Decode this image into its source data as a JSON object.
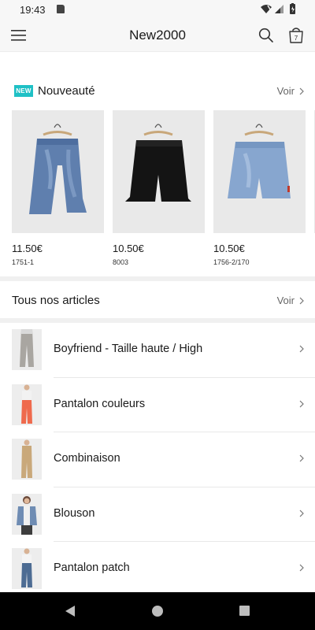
{
  "status_bar": {
    "time": "19:43"
  },
  "app_bar": {
    "title": "New2000",
    "cart_count": "7"
  },
  "new_section": {
    "badge": "NEW",
    "title": "Nouveauté",
    "see_all": "Voir",
    "products": [
      {
        "price": "11.50€",
        "ref": "1751-1",
        "color": "#5f7fae"
      },
      {
        "price": "10.50€",
        "ref": "8003",
        "color": "#141414"
      },
      {
        "price": "10.50€",
        "ref": "1756-2/170",
        "color": "#87a6cf"
      }
    ]
  },
  "all_section": {
    "title": "Tous nos articles",
    "see_all": "Voir"
  },
  "categories": [
    {
      "label": "Boyfriend - Taille haute / High",
      "color": "#a9a6a1"
    },
    {
      "label": "Pantalon couleurs",
      "color": "#ef6a4d"
    },
    {
      "label": "Combinaison",
      "color": "#c9a87a"
    },
    {
      "label": "Blouson",
      "color": "#6f8cb3"
    },
    {
      "label": "Pantalon patch",
      "color": "#4d6c93"
    }
  ]
}
